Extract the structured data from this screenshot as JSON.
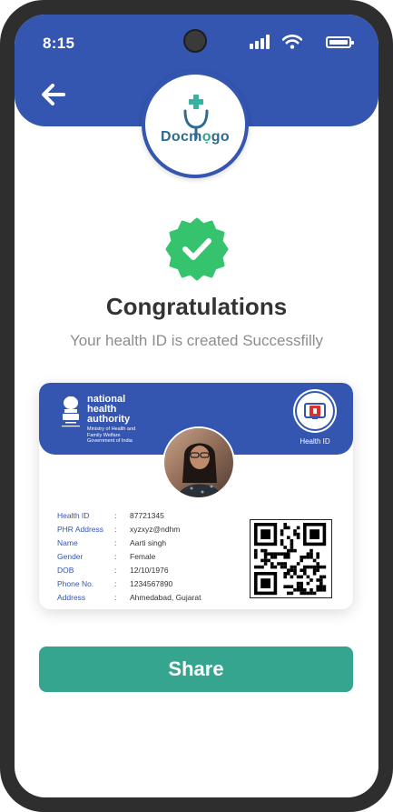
{
  "status_bar": {
    "time": "8:15"
  },
  "app": {
    "logo_text_left": "Docm",
    "logo_text_right": "go",
    "logo_pin_icon": "location-pin-icon"
  },
  "success": {
    "title": "Congratulations",
    "message": "Your health ID is created Successfilly"
  },
  "card": {
    "authority_name": "national health authority",
    "ministry": "Ministry of Health and Family Welfare",
    "government": "Government of India",
    "emblem_caption": "सत्यमेव जयते",
    "id_label": "Health ID",
    "fields": [
      {
        "key": "Health ID",
        "value": "87721345"
      },
      {
        "key": "PHR Address",
        "value": "xyzxyz@ndhm"
      },
      {
        "key": "Name",
        "value": "Aarti singh"
      },
      {
        "key": "Gender",
        "value": "Female"
      },
      {
        "key": "DOB",
        "value": "12/10/1976"
      },
      {
        "key": "Phone No.",
        "value": "1234567890"
      },
      {
        "key": "Address",
        "value": "Ahmedabad, Gujarat"
      }
    ],
    "separator": ":"
  },
  "actions": {
    "share_label": "Share"
  },
  "colors": {
    "primary": "#3455b0",
    "success": "#36c36e",
    "share": "#36a58f"
  }
}
